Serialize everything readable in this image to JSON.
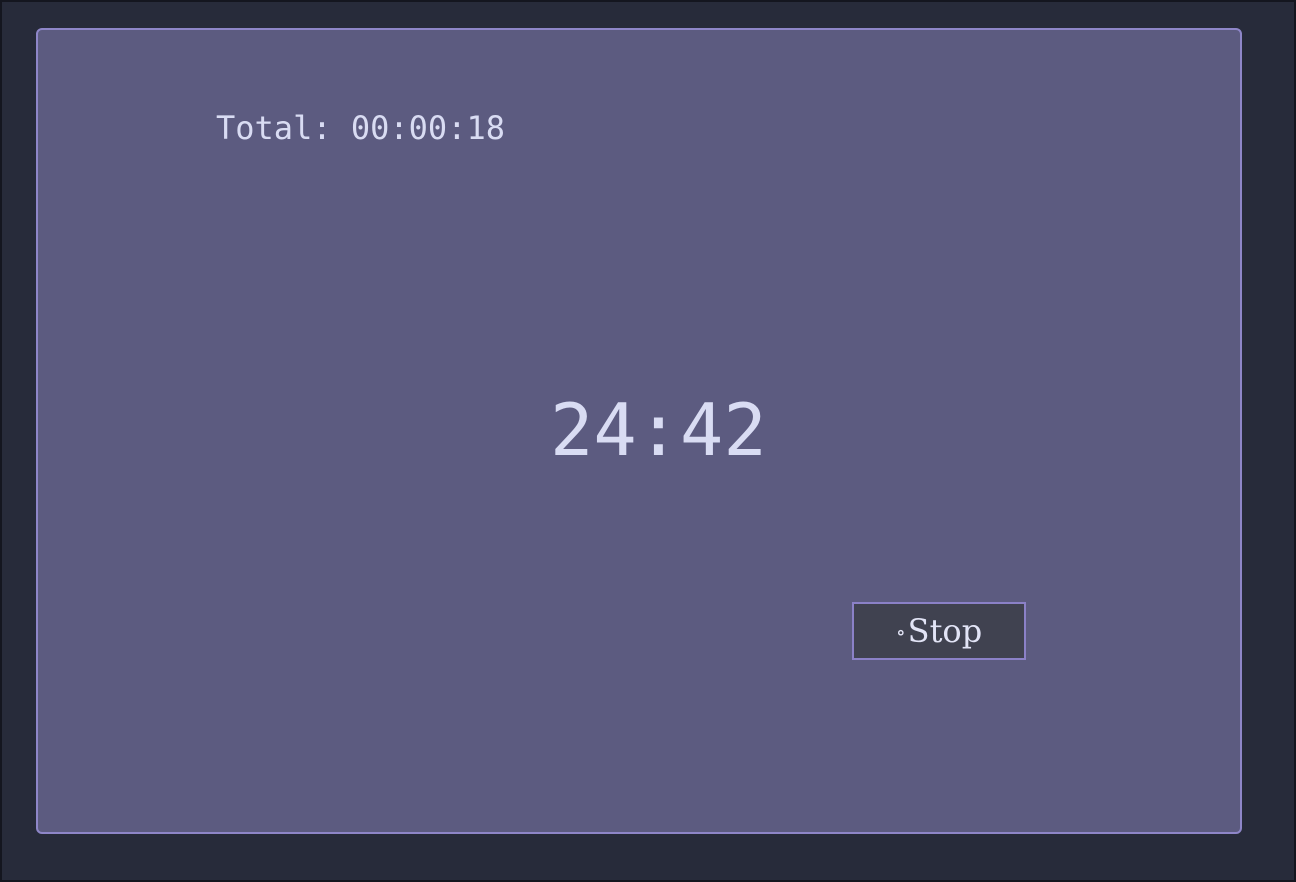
{
  "timer": {
    "total_label": "Total:",
    "total_value": "00:00:18",
    "countdown": "24:42"
  },
  "controls": {
    "stop_icon": "∘",
    "stop_label": "Stop"
  },
  "colors": {
    "background": "#272b3a",
    "panel": "#5c5b80",
    "panel_border": "#8e86c8",
    "text": "#d9dcf3",
    "button_bg": "#404250",
    "button_border": "#8b81c7"
  }
}
